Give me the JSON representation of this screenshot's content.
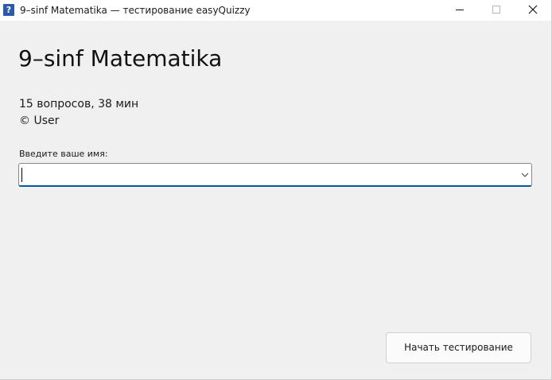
{
  "window": {
    "icon_glyph": "?",
    "title": "9–sinf Matematika — тестирование easyQuizzy",
    "controls": [
      "minimize-icon",
      "maximize-icon",
      "close-icon"
    ]
  },
  "main": {
    "heading": "9–sinf Matematika",
    "summary": "15 вопросов, 38 мин",
    "author": "© User",
    "name_label": "Введите ваше имя:",
    "name_value": "",
    "start_button": "Начать тестирование"
  },
  "colors": {
    "titlebar": "#ffffff",
    "background": "#f0f0f0",
    "icon": "#2a5aa8",
    "focus_accent": "#005a9e"
  }
}
